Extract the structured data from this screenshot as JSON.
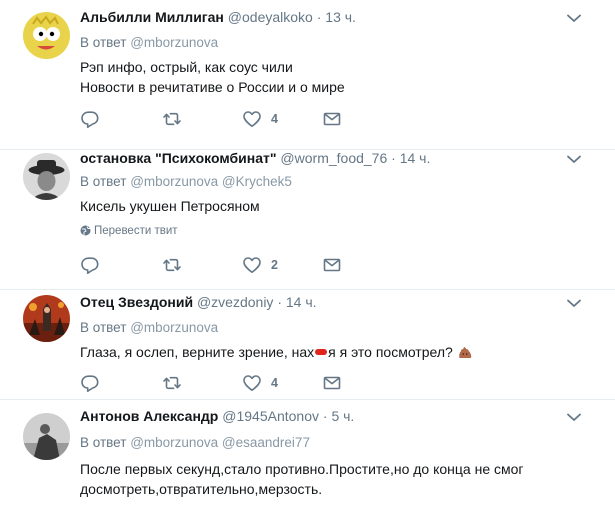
{
  "tweets": [
    {
      "name": "Альбилли Миллиган",
      "handle": "@odeyalkoko",
      "separator": "·",
      "time": "13 ч.",
      "reply_prefix": "В ответ",
      "reply_mentions": "@mborzunova",
      "lines": [
        "Рэп инфо, острый, как соус чили",
        "Новости в речитативе о России и о мире"
      ],
      "likes": "4"
    },
    {
      "name": "остановка \"Психокомбинат\"",
      "handle": "@worm_food_76",
      "separator": "·",
      "time": "14 ч.",
      "reply_prefix": "В ответ",
      "reply_mentions": "@mborzunova @Krychek5",
      "lines": [
        "Кисель укушен Петросяном"
      ],
      "translate": "Перевести твит",
      "likes": "2"
    },
    {
      "name": "Отец Звездоний",
      "handle": "@zvezdoniy",
      "separator": "·",
      "time": "14 ч.",
      "reply_prefix": "В ответ",
      "reply_mentions": "@mborzunova",
      "line_start": "Глаза, я ослеп, верните зрение, нах",
      "line_end": "я я это посмотрел?",
      "likes": "4"
    },
    {
      "name": "Антонов Александр",
      "handle": "@1945Antonov",
      "separator": "·",
      "time": "5 ч.",
      "reply_prefix": "В ответ",
      "reply_mentions": "@mborzunova @esaandrei77",
      "lines": [
        "После первых секунд,стало противно.Простите,но до конца не смог",
        "досмотреть,отвратительно,мерзость."
      ]
    }
  ],
  "icons": {
    "reply": "reply-icon",
    "retweet": "retweet-icon",
    "like": "heart-icon",
    "dm": "envelope-icon",
    "more": "chevron-down-icon",
    "globe": "globe-icon",
    "emoji": "poop-emoji"
  },
  "colors": {
    "icon": "#657786",
    "border": "#e6ecf0",
    "name": "#14171a",
    "meta": "#657786"
  }
}
